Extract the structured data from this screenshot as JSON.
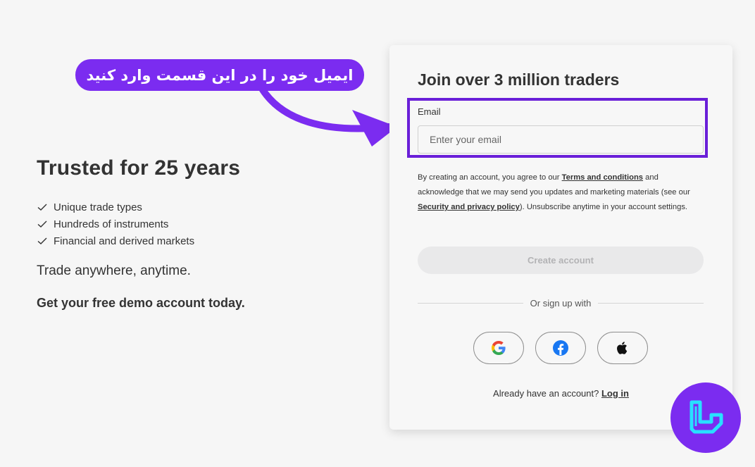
{
  "annotation": {
    "text": "ایمیل خود را در این قسمت وارد کنید"
  },
  "promo": {
    "title": "Trusted for 25 years",
    "features": [
      "Unique trade types",
      "Hundreds of instruments",
      "Financial and derived markets"
    ],
    "tagline": "Trade anywhere, anytime.",
    "cta": "Get your free demo account today."
  },
  "signup": {
    "title": "Join over 3 million traders",
    "email_label": "Email",
    "email_placeholder": "Enter your email",
    "email_value": "",
    "terms_pre": "By creating an account, you agree to our ",
    "terms_link": "Terms and conditions",
    "terms_mid": " and acknowledge that we may send you updates and marketing materials (see our ",
    "privacy_link": "Security and privacy policy",
    "terms_post": "). Unsubscribe anytime in your account settings.",
    "create_button": "Create account",
    "divider_text": "Or sign up with",
    "social": [
      {
        "name": "google",
        "icon": "google-icon"
      },
      {
        "name": "facebook",
        "icon": "facebook-icon"
      },
      {
        "name": "apple",
        "icon": "apple-icon"
      }
    ],
    "login_prompt": "Already have an account? ",
    "login_link": "Log in"
  },
  "colors": {
    "accent_purple": "#7b2cf0",
    "highlight_border": "#6a1fd8",
    "disabled_button_bg": "#e9e9ea",
    "disabled_button_text": "#b3b3b5",
    "logo_cyan": "#28e0ff"
  }
}
